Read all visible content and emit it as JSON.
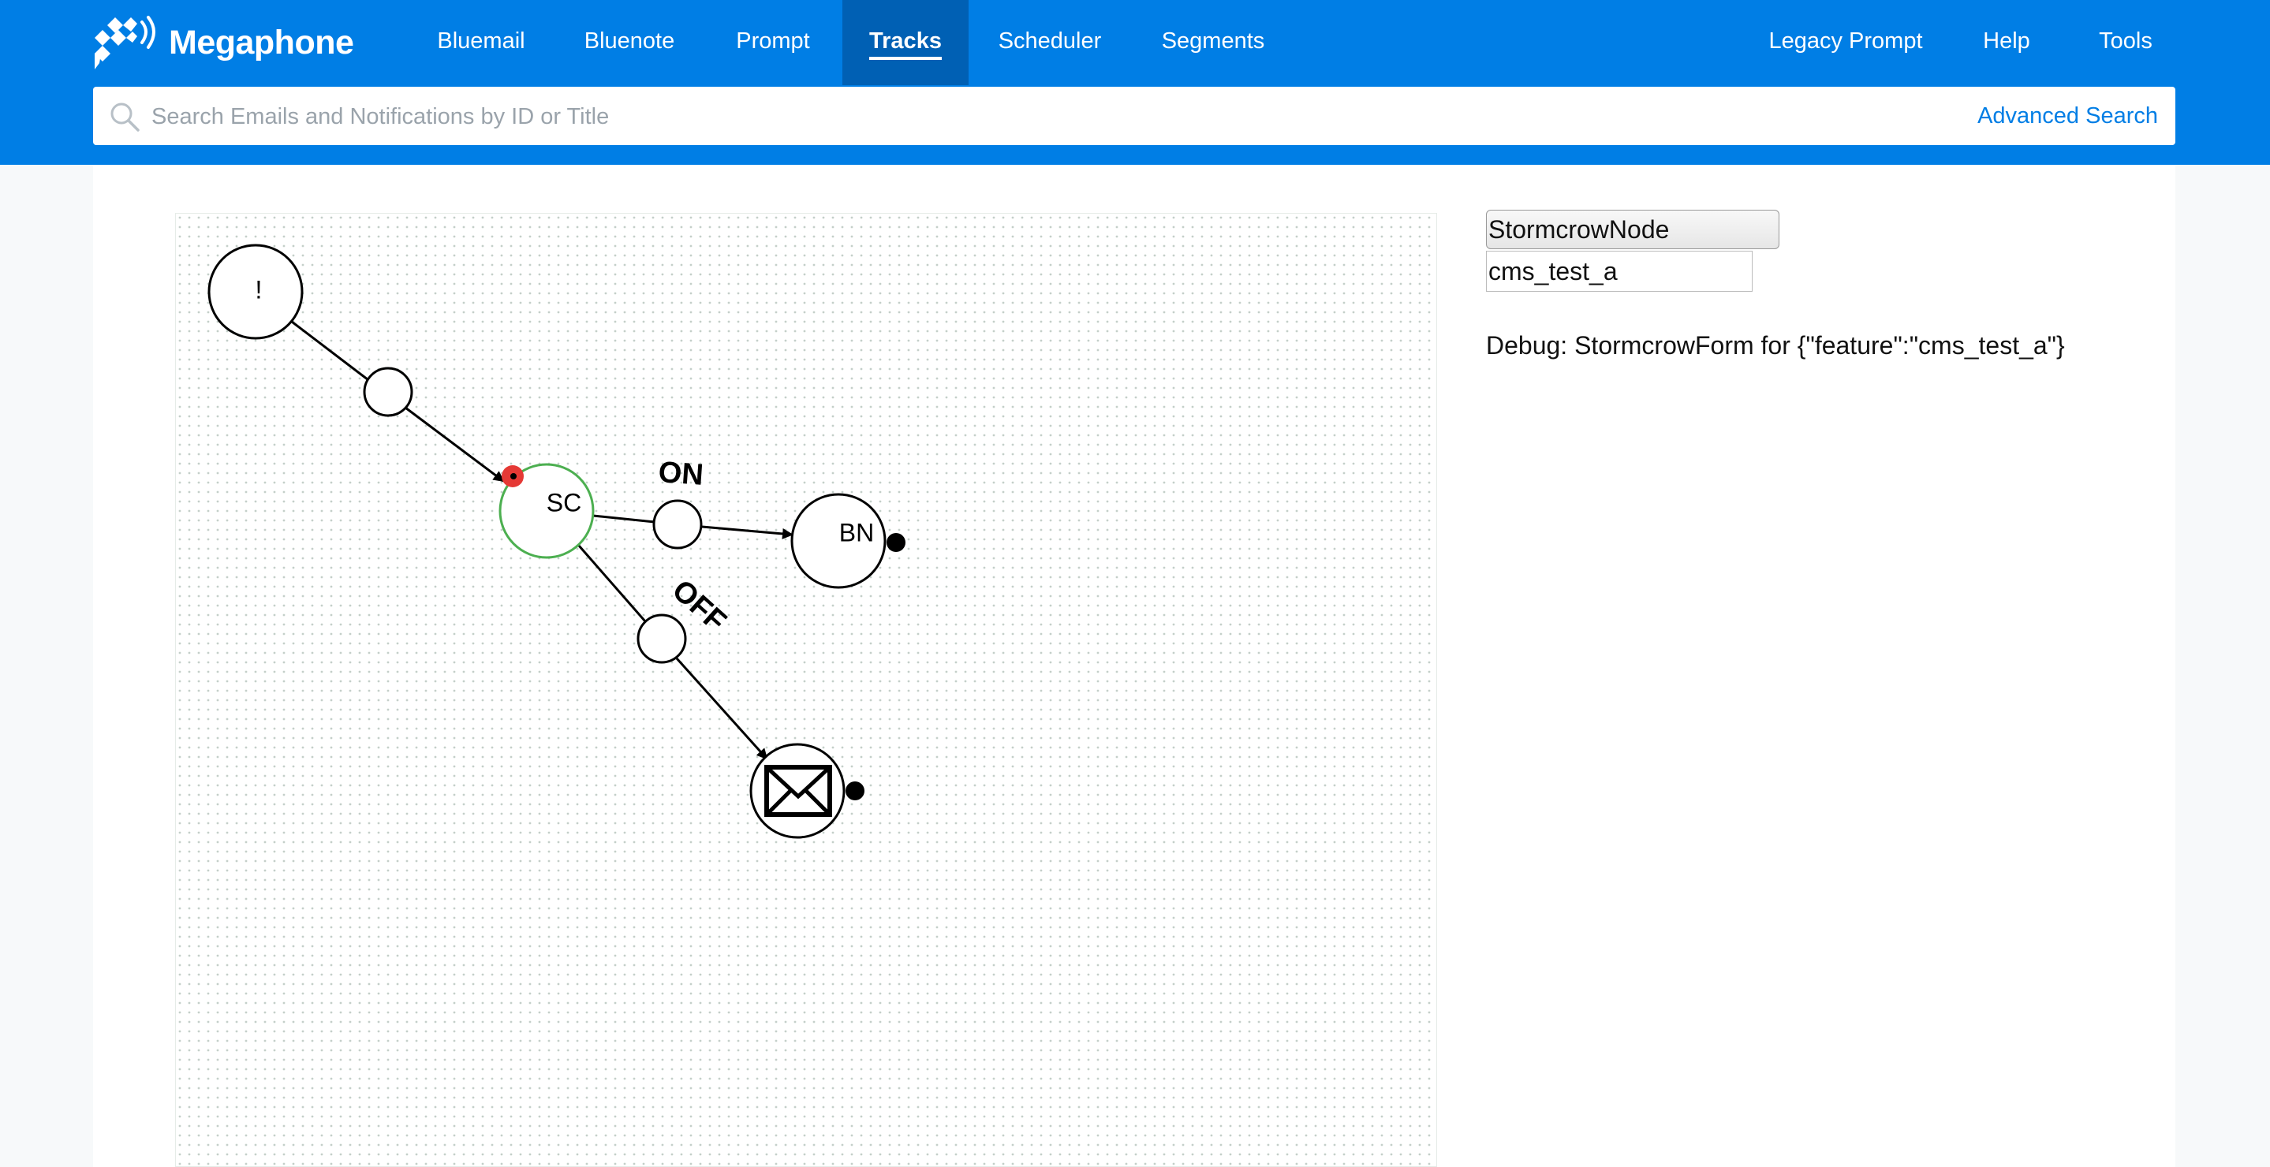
{
  "brand": {
    "name": "Megaphone",
    "logo_icon": "megaphone-logo-icon"
  },
  "nav": {
    "items": [
      {
        "label": "Bluemail",
        "active": false
      },
      {
        "label": "Bluenote",
        "active": false
      },
      {
        "label": "Prompt",
        "active": false
      },
      {
        "label": "Tracks",
        "active": true
      },
      {
        "label": "Scheduler",
        "active": false
      },
      {
        "label": "Segments",
        "active": false
      }
    ],
    "right_items": [
      {
        "label": "Legacy Prompt"
      },
      {
        "label": "Help"
      },
      {
        "label": "Tools"
      }
    ]
  },
  "search": {
    "placeholder": "Search Emails and Notifications by ID or Title",
    "value": "",
    "advanced_label": "Advanced Search",
    "icon": "search-icon"
  },
  "graph": {
    "nodes": {
      "trigger": {
        "label": "!"
      },
      "stormcrow": {
        "label": "SC"
      },
      "bluenote": {
        "label": "BN"
      },
      "email": {
        "icon": "envelope-icon"
      }
    },
    "edges": {
      "on": {
        "label": "ON"
      },
      "off": {
        "label": "OFF"
      }
    }
  },
  "form": {
    "node_type": "StormcrowNode",
    "feature_value": "cms_test_a",
    "debug": "Debug: StormcrowForm for {\"feature\":\"cms_test_a\"}"
  },
  "colors": {
    "header": "#007ee5",
    "nav_active": "#0060b4",
    "link": "#007ee5",
    "selected_node_border": "#4caf50",
    "port_active": "#e53935"
  }
}
